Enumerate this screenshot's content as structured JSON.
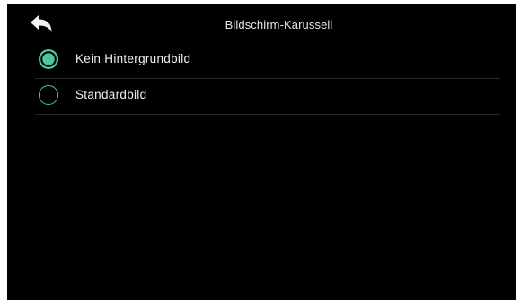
{
  "header": {
    "title": "Bildschirm-Karussell",
    "back_icon": "back-arrow-icon"
  },
  "options": [
    {
      "label": "Kein Hintergrundbild",
      "selected": true
    },
    {
      "label": "Standardbild",
      "selected": false
    }
  ],
  "colors": {
    "background": "#000000",
    "accent": "#4fc79a",
    "text": "#f0f0f0",
    "divider": "#2a2a2a"
  }
}
